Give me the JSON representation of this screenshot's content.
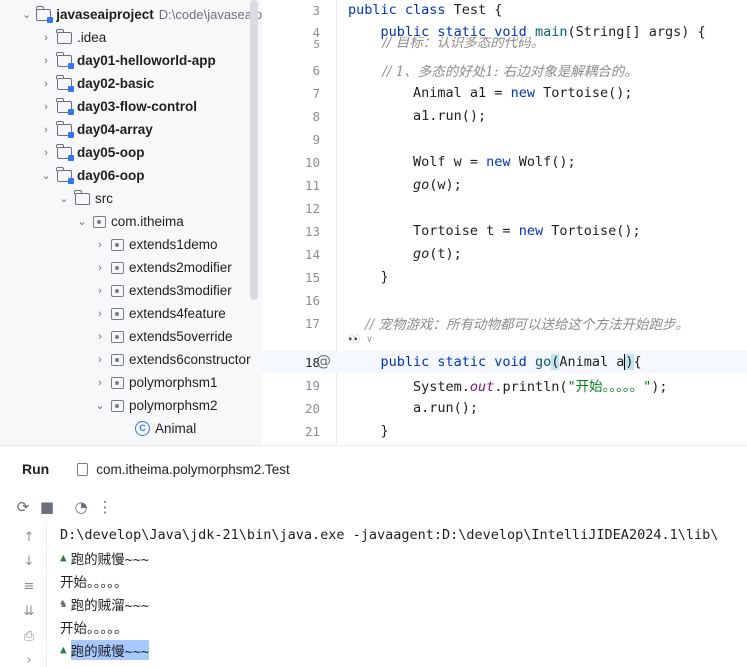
{
  "project_tree": {
    "items": [
      {
        "label": "javaseaiproject",
        "path": "D:\\code\\javaseaip",
        "expanded": true,
        "icon": "module-folder-icon"
      },
      {
        "label": ".idea",
        "expanded": false,
        "icon": "folder-icon"
      },
      {
        "label": "day01-helloworld-app",
        "expanded": false,
        "icon": "module-folder-icon"
      },
      {
        "label": "day02-basic",
        "expanded": false,
        "icon": "module-folder-icon"
      },
      {
        "label": "day03-flow-control",
        "expanded": false,
        "icon": "module-folder-icon"
      },
      {
        "label": "day04-array",
        "expanded": false,
        "icon": "module-folder-icon"
      },
      {
        "label": "day05-oop",
        "expanded": false,
        "icon": "module-folder-icon"
      },
      {
        "label": "day06-oop",
        "expanded": true,
        "icon": "module-folder-icon"
      },
      {
        "label": "src",
        "expanded": true,
        "icon": "folder-icon"
      },
      {
        "label": "com.itheima",
        "expanded": true,
        "icon": "package-icon"
      },
      {
        "label": "extends1demo",
        "expanded": false,
        "icon": "package-icon"
      },
      {
        "label": "extends2modifier",
        "expanded": false,
        "icon": "package-icon"
      },
      {
        "label": "extends3modifier",
        "expanded": false,
        "icon": "package-icon"
      },
      {
        "label": "extends4feature",
        "expanded": false,
        "icon": "package-icon"
      },
      {
        "label": "extends5override",
        "expanded": false,
        "icon": "package-icon"
      },
      {
        "label": "extends6constructor",
        "expanded": false,
        "icon": "package-icon"
      },
      {
        "label": "polymorphsm1",
        "expanded": false,
        "icon": "package-icon"
      },
      {
        "label": "polymorphsm2",
        "expanded": true,
        "icon": "package-icon"
      },
      {
        "label": "Animal",
        "icon": "class-icon",
        "icon_glyph": "C"
      }
    ]
  },
  "editor": {
    "lines": [
      {
        "n": "3",
        "text": "public class Test {"
      },
      {
        "n": "4",
        "text": "    public static void main(String[] args) {"
      },
      {
        "n": "5",
        "text": "        // 目标：认识多态的代码。"
      },
      {
        "n": "6",
        "text": "        // 1、多态的好处1: 右边对象是解耦合的。"
      },
      {
        "n": "7",
        "text": "        Animal a1 = new Tortoise();"
      },
      {
        "n": "8",
        "text": "        a1.run();"
      },
      {
        "n": "9",
        "text": ""
      },
      {
        "n": "10",
        "text": "        Wolf w = new Wolf();"
      },
      {
        "n": "11",
        "text": "        go(w);"
      },
      {
        "n": "12",
        "text": ""
      },
      {
        "n": "13",
        "text": "        Tortoise t = new Tortoise();"
      },
      {
        "n": "14",
        "text": "        go(t);"
      },
      {
        "n": "15",
        "text": "    }"
      },
      {
        "n": "16",
        "text": ""
      },
      {
        "n": "17",
        "text": "    // 宠物游戏：所有动物都可以送给这个方法开始跑步。"
      },
      {
        "n": "18",
        "text": "    public static void go(Animal a){"
      },
      {
        "n": "19",
        "text": "        System.out.println(\"开始。。。。。\");"
      },
      {
        "n": "20",
        "text": "        a.run();"
      },
      {
        "n": "21",
        "text": "    }"
      }
    ],
    "inlay_hint": "👀 ∨",
    "gutter_marker": "@",
    "current_line": "18"
  },
  "run_panel": {
    "title": "Run",
    "tab_label": "com.itheima.polymorphsm2.Test",
    "toolbar": [
      "rerun-icon",
      "stop-icon",
      "profiler-icon",
      "more-icon"
    ],
    "side_tools": [
      "up-icon",
      "down-icon",
      "soft-wrap-icon",
      "scroll-to-end-icon",
      "print-icon",
      "expand-icon"
    ],
    "console": [
      {
        "text": "D:\\develop\\Java\\jdk-21\\bin\\java.exe -javaagent:D:\\develop\\IntelliJIDEA2024.1\\lib\\",
        "prefix": ""
      },
      {
        "text": "跑的贼慢~~~",
        "prefix": "turtle"
      },
      {
        "text": "开始。。。。。",
        "prefix": ""
      },
      {
        "text": "跑的贼溜~~~",
        "prefix": "wolf"
      },
      {
        "text": "开始。。。。。",
        "prefix": ""
      },
      {
        "text": "跑的贼慢~~~",
        "prefix": "turtle"
      }
    ]
  }
}
